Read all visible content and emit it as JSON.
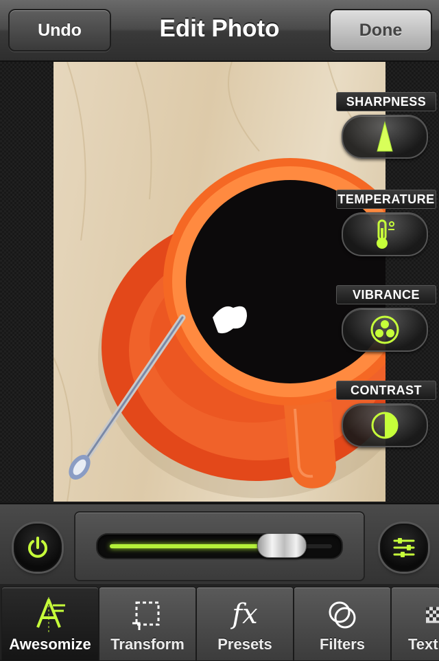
{
  "nav": {
    "undo_label": "Undo",
    "title": "Edit Photo",
    "done_label": "Done"
  },
  "adjustments": [
    {
      "label": "SHARPNESS",
      "icon": "sharpness-icon"
    },
    {
      "label": "TEMPERATURE",
      "icon": "thermometer-icon"
    },
    {
      "label": "VIBRANCE",
      "icon": "vibrance-icon"
    },
    {
      "label": "CONTRAST",
      "icon": "contrast-icon"
    }
  ],
  "slider": {
    "value_fraction": 0.78
  },
  "tabs": [
    {
      "label": "Awesomize",
      "icon": "awesomize-icon",
      "active": true
    },
    {
      "label": "Transform",
      "icon": "crop-icon"
    },
    {
      "label": "Presets",
      "icon": "fx-icon"
    },
    {
      "label": "Filters",
      "icon": "filters-icon"
    },
    {
      "label": "Text",
      "icon": "text-icon"
    }
  ],
  "colors": {
    "accent": "#b4f03a",
    "cup": "#ec5a1c",
    "coffee": "#0c0a0b"
  }
}
